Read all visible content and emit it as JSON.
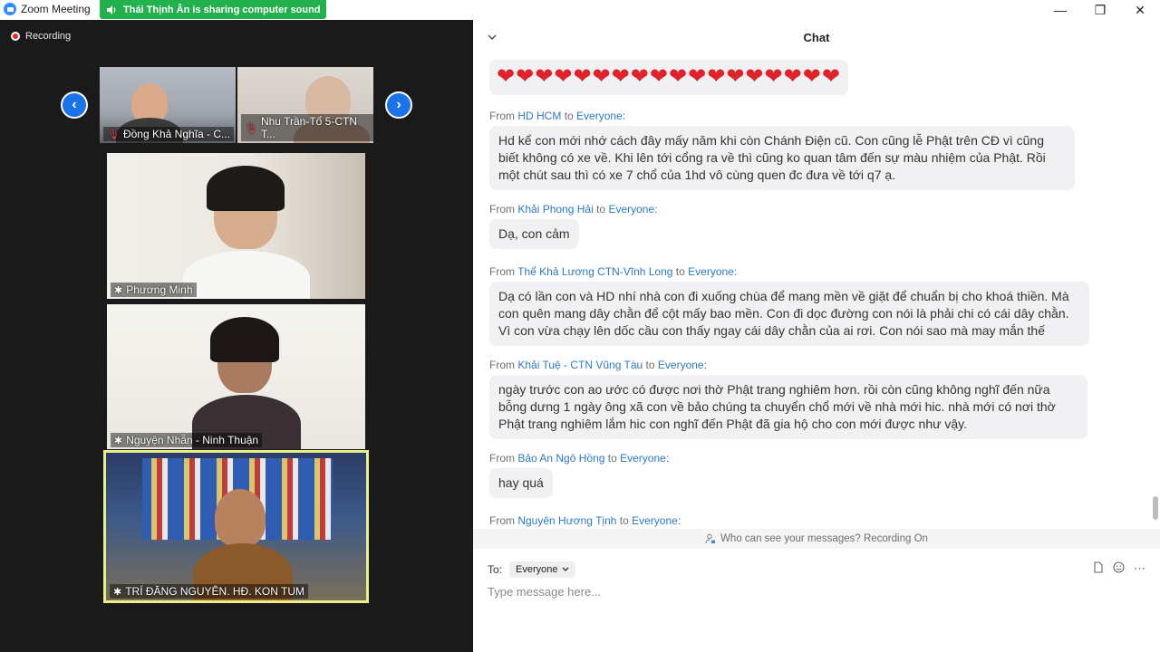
{
  "app": {
    "title": "Zoom Meeting",
    "share_banner": "Thái Thịnh Ân is sharing computer sound",
    "recording_label": "Recording"
  },
  "window_controls": [
    "—",
    "❐",
    "✕"
  ],
  "gallery": {
    "prev_icon": "chevron-left-icon",
    "next_icon": "chevron-right-icon",
    "participants": [
      {
        "name": "Đồng Khả Nghĩa -  C...",
        "muted": true
      },
      {
        "name": "Nhu Trần-Tổ 5-CTN T...",
        "muted": true
      },
      {
        "name": "Phương Minh",
        "pinned": true
      },
      {
        "name": "Nguyện Nhẫn - Ninh Thuận",
        "pinned": true
      },
      {
        "name": "TRÍ ĐĂNG NGUYÊN. HĐ. KON TUM",
        "pinned": true,
        "active_speaker": true
      }
    ]
  },
  "chat": {
    "title": "Chat",
    "hearts": "❤❤❤❤❤❤❤❤❤❤❤❤❤❤❤❤❤❤",
    "from_word": "From",
    "to_word": "to",
    "messages": [
      {
        "from": "HD HCM",
        "to": "Everyone:",
        "text": "Hd kể con mới nhớ cách đây mấy năm khi còn Chánh Điện cũ. Con cũng lễ Phật trên CĐ vì cũng biết không có xe về. Khi lên tới cổng ra về thì cũng ko quan tâm đến sự màu nhiệm của Phật. Rồi một chút sau thì có xe 7 chổ của 1hd vô cùng quen đc đưa về tới q7 ạ."
      },
      {
        "from": "Khải Phong Hải",
        "to": "Everyone:",
        "text": "Dạ, con cảm"
      },
      {
        "from": "Thể Khả Lương CTN-Vĩnh Long",
        "to": "Everyone:",
        "text": "Dạ có lần con và HD nhí nhà con đi xuống chùa để mang mền về giặt để chuẩn bị cho khoá thiền. Mà con quên mang dây chằn để cột mấy bao mền. Con đi dọc đường con nói là phải chi có cái dây chằn. Vì con vừa chạy lên dốc cầu con thấy ngay cái dây chằn của ai rơi. Con nói sao mà may mắn thế"
      },
      {
        "from": "Khải Tuệ - CTN Vũng Tàu",
        "to": "Everyone:",
        "text": "ngày trước con ao ước có được nơi thờ Phật trang nghiêm hơn. rồi còn cũng không nghĩ đến nữa bỗng dưng 1 ngày ông xã con về bảo chúng ta chuyển chổ mới về nhà mới hic. nhà mới có nơi thờ Phật trang nghiêm lắm hic con nghĩ đến Phật đã gia hộ cho con mới được như vậy."
      },
      {
        "from": "Bảo An Ngô Hồng",
        "to": "Everyone:",
        "text": "hay quá"
      },
      {
        "from": "Nguyên Hương Tịnh",
        "to": "Everyone:",
        "text": ""
      }
    ],
    "privacy_text": "Who can see your messages? Recording On",
    "to_label": "To:",
    "to_value": "Everyone",
    "input_placeholder": "Type message here..."
  },
  "colors": {
    "zoom_blue": "#2d8cff",
    "share_green": "#23b14d",
    "active_speaker_border": "#e8f08a",
    "sender_link": "#2d79c7",
    "heart_red": "#e0222a"
  }
}
